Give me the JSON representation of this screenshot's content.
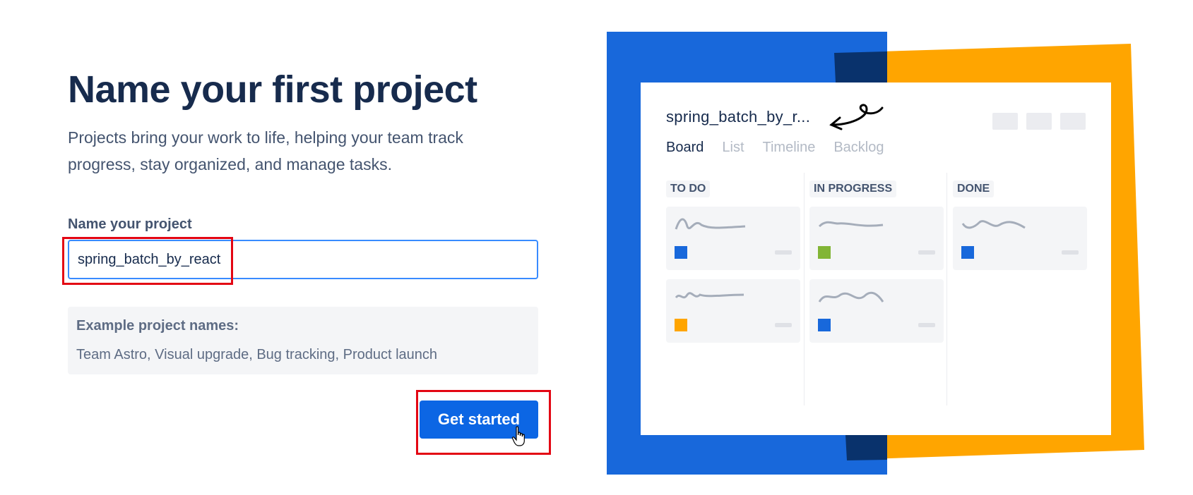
{
  "form": {
    "title": "Name your first project",
    "subtitle": "Projects bring your work to life, helping your team track progress, stay organized, and manage tasks.",
    "field_label": "Name your project",
    "project_name_value": "spring_batch_by_react",
    "examples_title": "Example project names:",
    "examples_list": "Team Astro, Visual upgrade, Bug tracking, Product launch",
    "submit_label": "Get started"
  },
  "illustration": {
    "board_title": "spring_batch_by_r...",
    "tabs": [
      "Board",
      "List",
      "Timeline",
      "Backlog"
    ],
    "columns": [
      "TO DO",
      "IN PROGRESS",
      "DONE"
    ],
    "colors": {
      "blue": "#1868db",
      "dark_blue": "#09326c",
      "yellow": "#ffa500",
      "card_blue": "#1868db",
      "card_green": "#82b536",
      "card_yellow": "#ffa500"
    }
  },
  "colors": {
    "accent": "#0c66e4",
    "input_border": "#388bff",
    "highlight": "#e30613"
  }
}
